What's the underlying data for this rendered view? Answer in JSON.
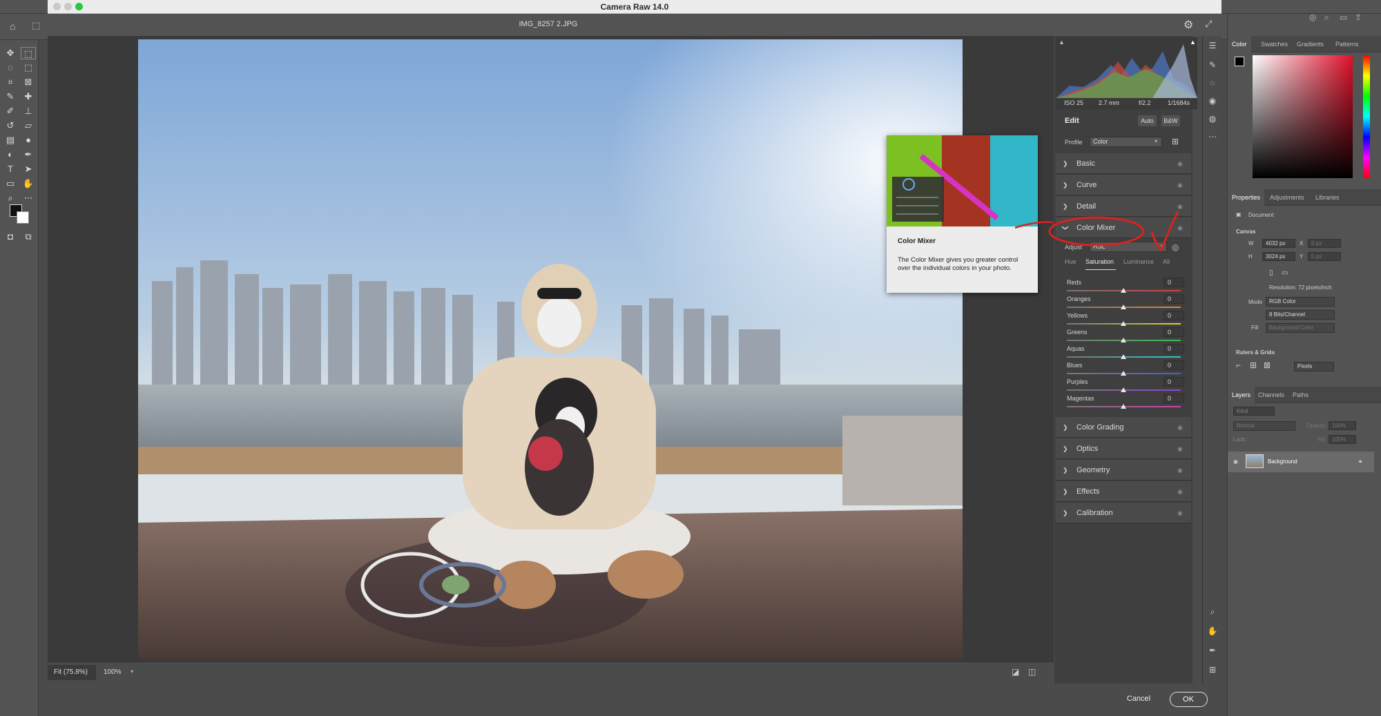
{
  "window": {
    "title": "Camera Raw 14.0",
    "filename": "IMG_8257 2.JPG"
  },
  "exif": {
    "iso": "ISO 25",
    "focal": "2.7 mm",
    "aperture": "f/2.2",
    "shutter": "1/1684s"
  },
  "edit": {
    "title": "Edit",
    "auto": "Auto",
    "bw": "B&W",
    "profile_label": "Profile",
    "profile_value": "Color"
  },
  "sections_top": [
    "Basic",
    "Curve",
    "Detail"
  ],
  "color_mixer": {
    "title": "Color Mixer",
    "adjust_label": "Adjust",
    "adjust_value": "HSL",
    "tabs": [
      "Hue",
      "Saturation",
      "Luminance",
      "All"
    ],
    "active_tab": "Saturation",
    "sliders": [
      {
        "name": "Reds",
        "value": "0"
      },
      {
        "name": "Oranges",
        "value": "0"
      },
      {
        "name": "Yellows",
        "value": "0"
      },
      {
        "name": "Greens",
        "value": "0"
      },
      {
        "name": "Aquas",
        "value": "0"
      },
      {
        "name": "Blues",
        "value": "0"
      },
      {
        "name": "Purples",
        "value": "0"
      },
      {
        "name": "Magentas",
        "value": "0"
      }
    ]
  },
  "sections_bottom": [
    "Color Grading",
    "Optics",
    "Geometry",
    "Effects",
    "Calibration"
  ],
  "tooltip": {
    "title": "Color Mixer",
    "body": "The Color Mixer gives you greater control over the individual colors in your photo."
  },
  "zoom": {
    "fit": "Fit (75.8%)",
    "hundred": "100%"
  },
  "footer": {
    "cancel": "Cancel",
    "ok": "OK"
  },
  "ps_panels": {
    "color_tabs": [
      "Color",
      "Swatches",
      "Gradients",
      "Patterns"
    ],
    "props_tabs": [
      "Properties",
      "Adjustments",
      "Libraries"
    ],
    "document": "Document",
    "canvas_label": "Canvas",
    "w_label": "W",
    "w_value": "4032 px",
    "h_label": "H",
    "h_value": "3024 px",
    "x_label": "X",
    "x_value": "0 px",
    "y_label": "Y",
    "y_value": "0 px",
    "resolution": "Resolution: 72 pixels/inch",
    "mode_label": "Mode",
    "mode_value": "RGB Color",
    "bits_value": "8 Bits/Channel",
    "fill_label": "Fill",
    "fill_value": "Background Color",
    "rulers_label": "Rulers & Grids",
    "units_value": "Pixels",
    "layers_tabs": [
      "Layers",
      "Channels",
      "Paths"
    ],
    "kind_placeholder": "Kind",
    "blend_value": "Normal",
    "opacity_label": "Opacity:",
    "opacity_value": "100%",
    "lock_label": "Lock:",
    "fill2_label": "Fill:",
    "fill2_value": "100%",
    "layer_name": "Background"
  }
}
